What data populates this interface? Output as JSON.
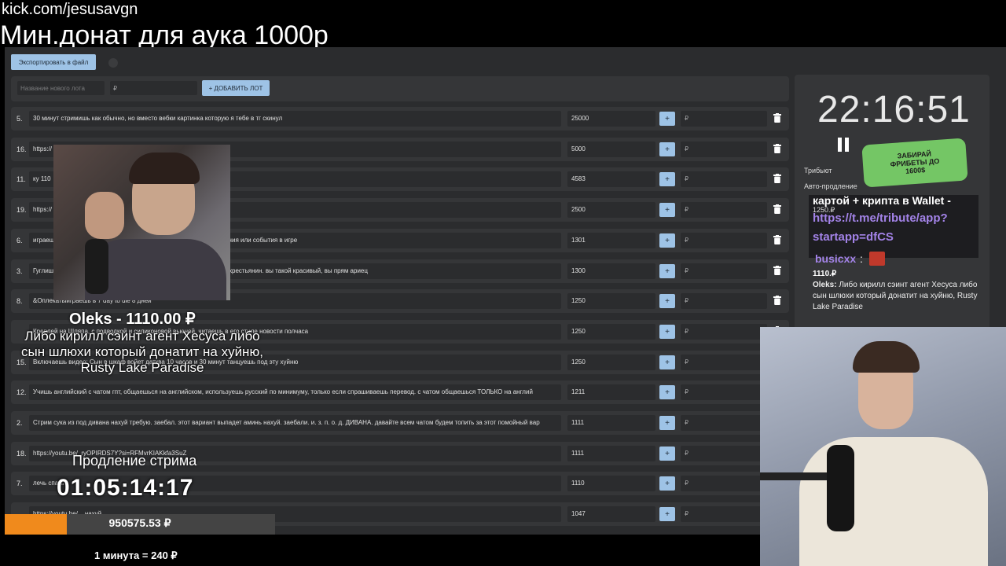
{
  "stream": {
    "url": "kick.com/jesusavgn",
    "title": "Мин.донат для аука 1000р"
  },
  "toolbar": {
    "export_label": "Экспортировать в файл"
  },
  "new_lot": {
    "name_placeholder": "Название нового лота",
    "price_placeholder": "₽",
    "add_label": "+ ДОБАВИТЬ ЛОТ"
  },
  "lots": [
    {
      "num": "5.",
      "text": "30 минут стримишь как обычно, но вместо вебки картинка которую я тебе в тг скинул",
      "amount": "25000",
      "rub": "₽"
    },
    {
      "num": "16.",
      "text": "https://",
      "amount": "5000",
      "rub": "₽"
    },
    {
      "num": "11.",
      "text": "ку 110",
      "amount": "4583",
      "rub": "₽"
    },
    {
      "num": "19.",
      "text": "https://",
      "amount": "2500",
      "rub": "₽"
    },
    {
      "num": "6.",
      "text": "играеш                                                        он твой компаньон читаешь донаты там тебе донатят задания или события в игре",
      "amount": "1301",
      "rub": "₽"
    },
    {
      "num": "3.",
      "text": "Гуглиш                                                        фотками говоришь. Господи, какой вы ариец, а я беззубый крестьянин. вы такой красивый, вы прям ариец",
      "amount": "1300",
      "rub": "₽"
    },
    {
      "num": "8.",
      "text": "&Оплекатыиграешь в 7 day to die 8 дней",
      "amount": "1250",
      "rub": "₽"
    },
    {
      "num": "",
      "text": "Креплей на Шляпа, с подводкой и силиконовой вьюной, читаешь в его стиле новости полчаса",
      "amount": "1250",
      "rub": "₽"
    },
    {
      "num": "15.",
      "text": "Включаешь видео: Сын в шкаф войет датква 10 часов и 30 минут танцуешь под эту хуйню",
      "amount": "1250",
      "rub": "₽"
    },
    {
      "num": "12.",
      "text": "Учишь английский с чатом гпт, общаешься на английском, используешь русский по минимуму, только если спрашиваешь перевод. с чатом общаешься ТОЛЬКО на англий",
      "amount": "1211",
      "rub": "₽"
    },
    {
      "num": "2.",
      "text": "Стрим сука из под дивана нахуй требую. заебал. этот вариант выпадет аминь нахуй. заебали. и. з. п. о. д. ДИВАНА. давайте всем чатом будем топить за этот помойный вар",
      "amount": "1111",
      "rub": "₽"
    },
    {
      "num": "18.",
      "text": "https://youtu.be/_ryOPIRDS7Y?si=RFMvrKIAKkfa3SuZ",
      "amount": "1111",
      "rub": "₽"
    },
    {
      "num": "7.",
      "text": "лечь спать",
      "amount": "1110",
      "rub": "₽"
    },
    {
      "num": "",
      "text": "https://youtu.be/...                                                             нахуй",
      "amount": "1047",
      "rub": "₽"
    }
  ],
  "timer_panel": {
    "time": "22:16:51",
    "tribute_label": "Трибьют",
    "auto_extend_label": "Авто-продление"
  },
  "promo": {
    "text": "ЗАБИРАЙ ФРИБЕТЫ ДО 1600$"
  },
  "chat_overlay": {
    "line1": "картой + крипта в Wallet -",
    "small": "1250.₽",
    "link1": "https://t.me/tribute/app?",
    "link2": "startapp=dfCS"
  },
  "last_donation": {
    "donor": "busicxx",
    "colon": ":",
    "amount": "1110.₽",
    "author": "Oleks:",
    "message": "Либо кирилл сэинт агент Хесуса либо сын шлюхи который донатит на хуйню, Rusty Lake Paradise"
  },
  "donation_alert": {
    "name": "Oleks - 1110.00 ₽",
    "text": "Либо кирилл сэинт агент Хесуса либо сын шлюхи который донатит на хуйню, Rusty Lake Paradise"
  },
  "extension": {
    "label": "Продление стрима",
    "timer": "01:05:14:17"
  },
  "progress": {
    "value": "950575.53 ₽",
    "fill_fraction": 0.23
  },
  "rate": {
    "text": "1 минута = 240 ₽"
  },
  "colors": {
    "accent": "#9ec3e6",
    "orange": "#f08a1c",
    "link": "#a383e8"
  }
}
